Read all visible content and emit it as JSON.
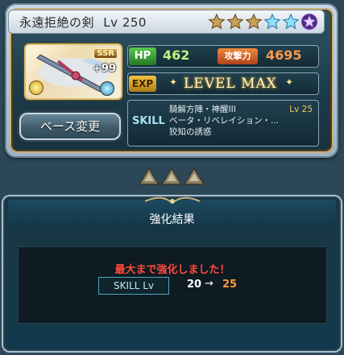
{
  "weapon": {
    "name": "永遠拒絶の剣",
    "level_label": "Lv",
    "level": "250",
    "stars_total": 6,
    "stars_filled_gold": 3,
    "stars_filled_blue": 2,
    "stars_special": 1,
    "rarity": "SSR",
    "plus": "+99"
  },
  "stats": {
    "hp_label": "HP",
    "hp_value": "462",
    "atk_label": "攻撃力",
    "atk_value": "4695",
    "exp_label": "EXP",
    "exp_status": "LEVEL MAX"
  },
  "skills": {
    "label": "SKILL",
    "lines": [
      "騎解方陣・神醒III",
      "ベータ・リベレイション・...",
      "狡知の誘惑"
    ],
    "skill_level": "Lv 25"
  },
  "buttons": {
    "base_change": "ベース変更"
  },
  "result": {
    "title": "強化結果",
    "message": "最大まで強化しました！",
    "skill_tag": "SKILL Lv",
    "from": "20",
    "arrow": "→",
    "to": "25"
  },
  "colors": {
    "hp_green": "#bff47d",
    "atk_orange": "#ff9a4a",
    "message_red": "#ff4a3a",
    "to_orange": "#ff9a3c"
  }
}
